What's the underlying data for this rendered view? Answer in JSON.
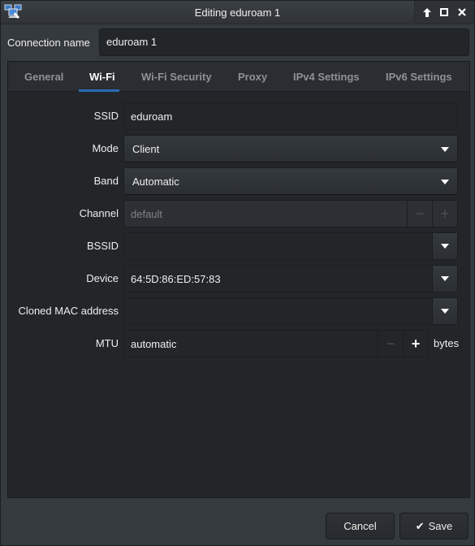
{
  "window": {
    "title": "Editing eduroam 1",
    "app_icon": "network-connections-icon",
    "controls": [
      {
        "name": "keep-above-button",
        "glyph": "🡅",
        "icon": "arrow-up-icon"
      },
      {
        "name": "maximize-button",
        "glyph": "☐",
        "icon": "maximize-icon"
      },
      {
        "name": "close-button",
        "glyph": "✕",
        "icon": "close-icon"
      }
    ]
  },
  "connection": {
    "label": "Connection name",
    "value": "eduroam 1"
  },
  "tabs": [
    {
      "label": "General",
      "active": false
    },
    {
      "label": "Wi-Fi",
      "active": true
    },
    {
      "label": "Wi-Fi Security",
      "active": false
    },
    {
      "label": "Proxy",
      "active": false
    },
    {
      "label": "IPv4 Settings",
      "active": false
    },
    {
      "label": "IPv6 Settings",
      "active": false
    }
  ],
  "form": {
    "ssid": {
      "label": "SSID",
      "value": "eduroam"
    },
    "mode": {
      "label": "Mode",
      "value": "Client"
    },
    "band": {
      "label": "Band",
      "value": "Automatic"
    },
    "channel": {
      "label": "Channel",
      "placeholder": "default",
      "minus": "−",
      "plus": "+"
    },
    "bssid": {
      "label": "BSSID",
      "value": ""
    },
    "device": {
      "label": "Device",
      "value": "64:5D:86:ED:57:83"
    },
    "cloned_mac": {
      "label": "Cloned MAC address",
      "value": ""
    },
    "mtu": {
      "label": "MTU",
      "value": "automatic",
      "minus": "−",
      "plus": "+",
      "unit": "bytes"
    }
  },
  "footer": {
    "cancel_label": "Cancel",
    "save_label": "Save",
    "save_icon": "✔"
  },
  "colors": {
    "accent": "#2a6bb4",
    "window_bg": "#353a3e",
    "field_bg": "#232629"
  }
}
